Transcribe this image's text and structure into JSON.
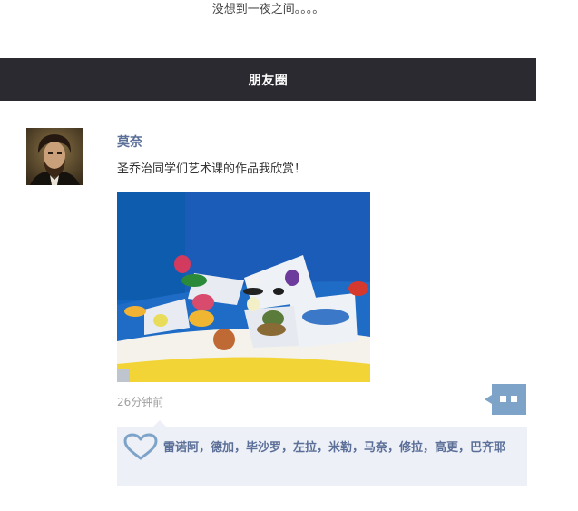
{
  "intro_text": "没想到一夜之间。。。。",
  "header": {
    "title": "朋友圈"
  },
  "post": {
    "author": "莫奈",
    "text": "圣乔治同学们艺术课的作品我欣赏！",
    "time": "26分钟前",
    "likes": "雷诺阿，德加，毕沙罗，左拉，米勒，马奈，修拉，高更，巴齐耶"
  },
  "icons": {
    "avatar": "portrait-avatar",
    "comment": "comment-bubble-icon",
    "like": "heart-icon"
  },
  "colors": {
    "header_bg": "#2b2a30",
    "name_link": "#5b6f98",
    "likes_bg": "#edf0f7",
    "comment_button": "#7ea3c8"
  }
}
